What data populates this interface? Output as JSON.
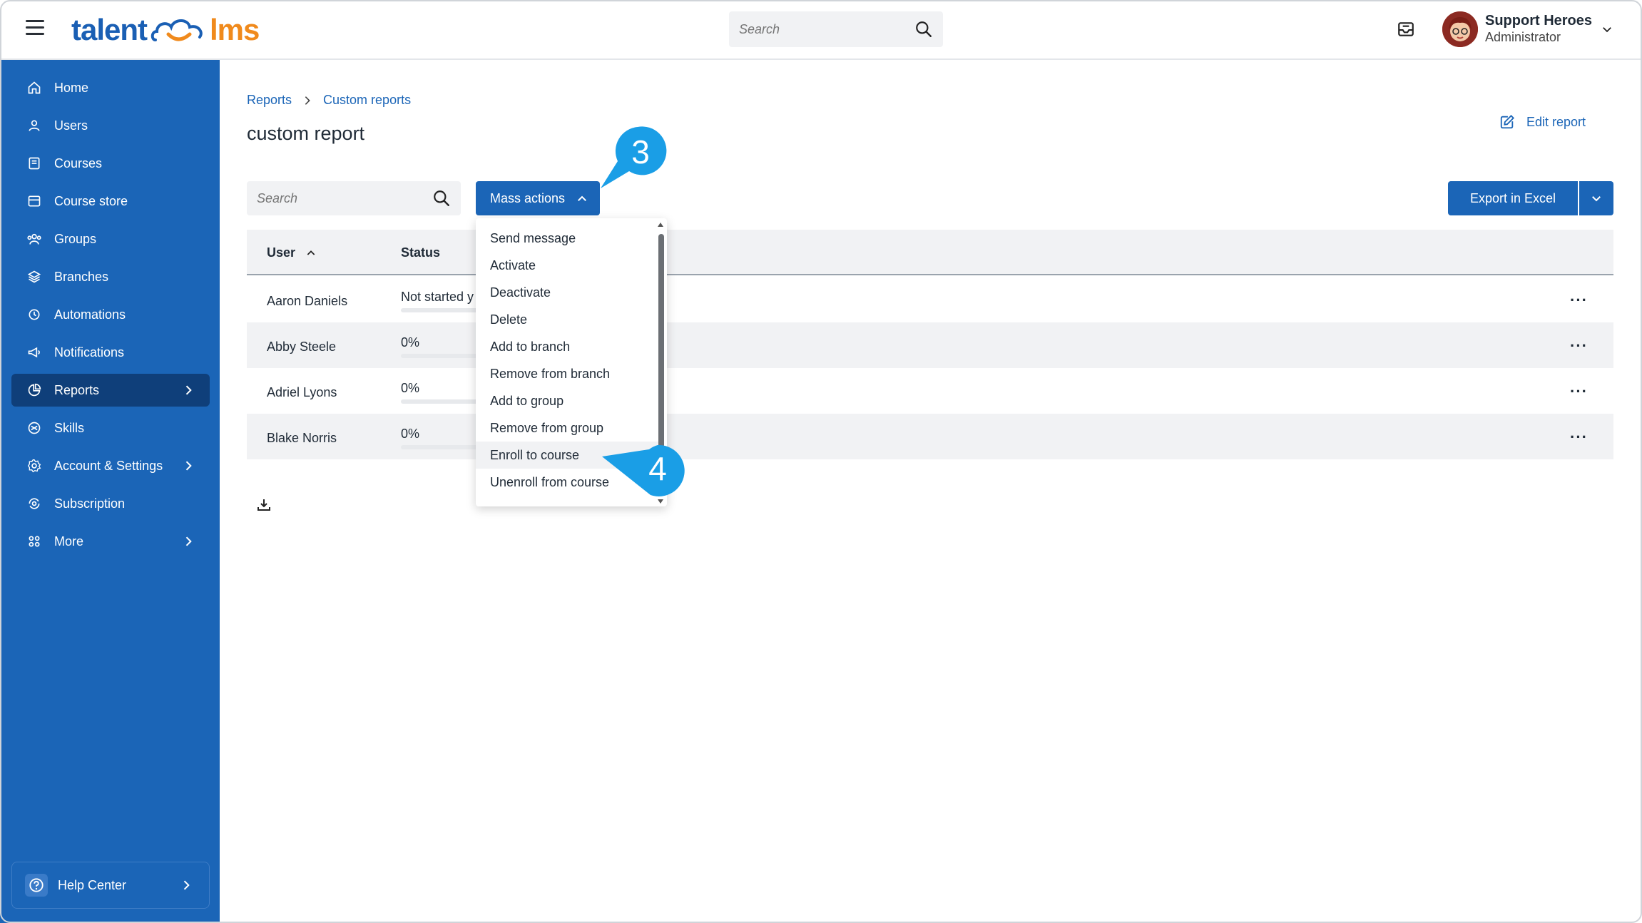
{
  "topbar": {
    "logo_left": "talent",
    "logo_right": "lms",
    "search_placeholder": "Search",
    "user_name": "Support Heroes",
    "user_role": "Administrator"
  },
  "sidebar": {
    "items": [
      {
        "label": "Home",
        "icon": "home-icon"
      },
      {
        "label": "Users",
        "icon": "user-icon"
      },
      {
        "label": "Courses",
        "icon": "book-icon"
      },
      {
        "label": "Course store",
        "icon": "store-icon"
      },
      {
        "label": "Groups",
        "icon": "groups-icon"
      },
      {
        "label": "Branches",
        "icon": "branches-icon"
      },
      {
        "label": "Automations",
        "icon": "automations-icon"
      },
      {
        "label": "Notifications",
        "icon": "megaphone-icon"
      },
      {
        "label": "Reports",
        "icon": "pie-chart-icon",
        "active": true
      },
      {
        "label": "Skills",
        "icon": "skills-icon"
      },
      {
        "label": "Account & Settings",
        "icon": "gear-icon"
      },
      {
        "label": "Subscription",
        "icon": "subscription-icon"
      },
      {
        "label": "More",
        "icon": "grid-icon"
      }
    ],
    "help_label": "Help Center"
  },
  "breadcrumb": {
    "root": "Reports",
    "current": "Custom reports"
  },
  "page": {
    "title": "custom report",
    "edit_label": "Edit report",
    "search_placeholder": "Search",
    "mass_actions_label": "Mass actions",
    "export_label": "Export in Excel"
  },
  "table": {
    "columns": [
      "User",
      "Status"
    ],
    "rows": [
      {
        "user": "Aaron Daniels",
        "status": "Not started y"
      },
      {
        "user": "Abby Steele",
        "status": "0%"
      },
      {
        "user": "Adriel Lyons",
        "status": "0%"
      },
      {
        "user": "Blake Norris",
        "status": "0%"
      }
    ]
  },
  "mass_actions_menu": {
    "items": [
      "Send message",
      "Activate",
      "Deactivate",
      "Delete",
      "Add to branch",
      "Remove from branch",
      "Add to group",
      "Remove from group",
      "Enroll to course",
      "Unenroll from course"
    ],
    "hovered": "Enroll to course"
  },
  "callouts": {
    "step_a": "3",
    "step_b": "4"
  },
  "colors": {
    "primary": "#1b65b7",
    "sidebar_active": "#0f3f7a",
    "callout": "#1a9ee6",
    "logo_orange": "#f08a1c"
  }
}
